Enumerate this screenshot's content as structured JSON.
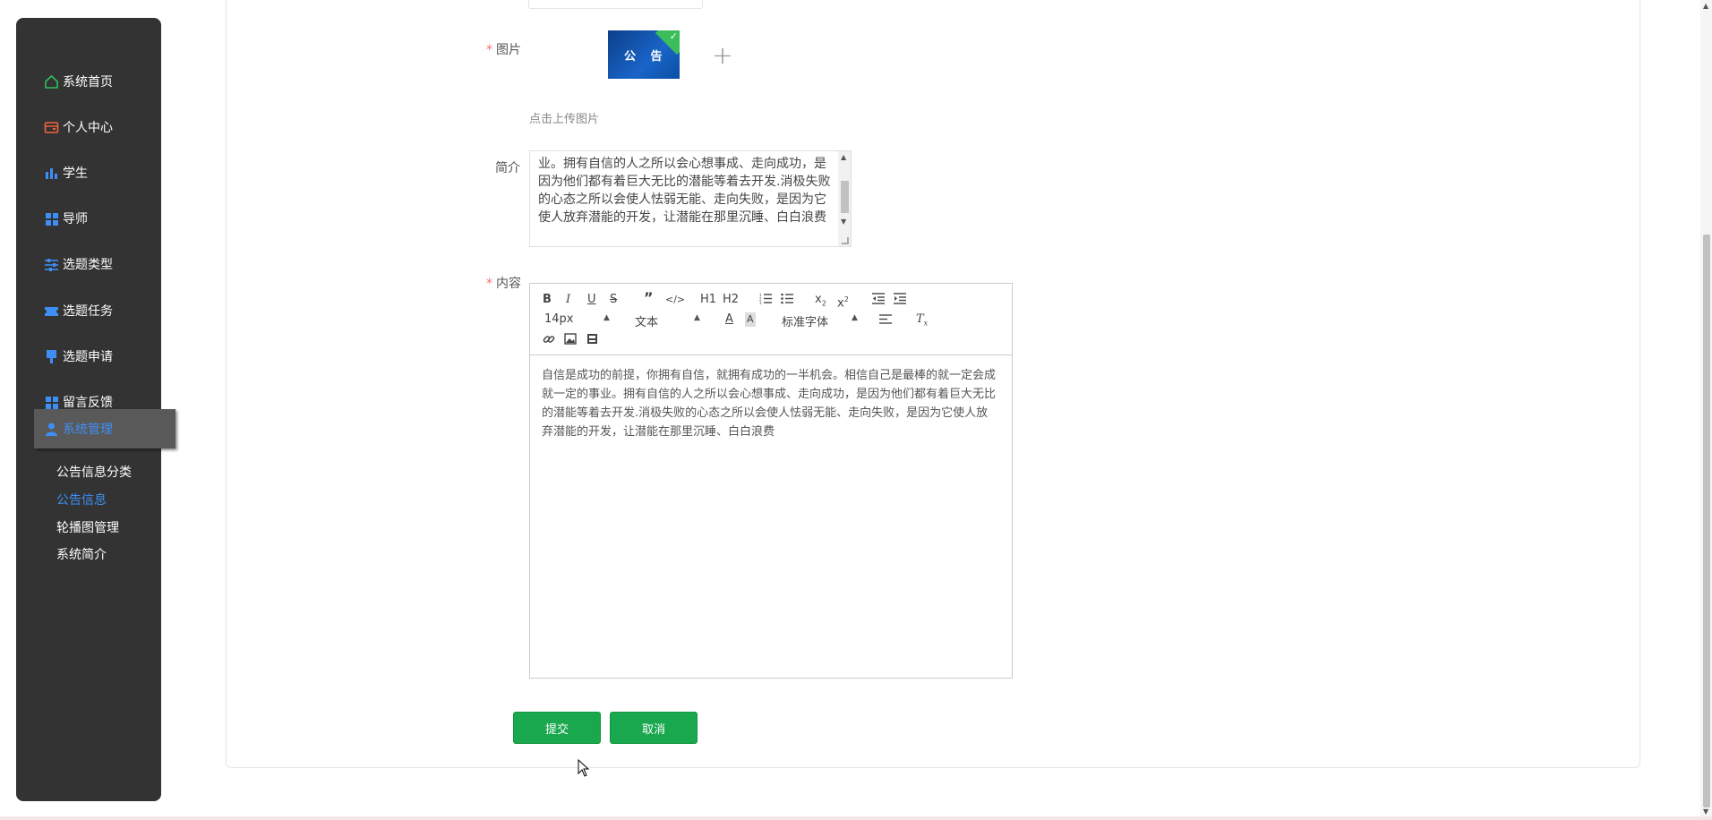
{
  "sidebar": {
    "items": [
      {
        "label": "系统首页",
        "icon": "home-icon",
        "color": "#2fbf5a"
      },
      {
        "label": "个人中心",
        "icon": "wallet-icon",
        "color": "#f0643c"
      },
      {
        "label": "学生",
        "icon": "bar-chart-icon",
        "color": "#3e8ff5"
      },
      {
        "label": "导师",
        "icon": "grid-icon",
        "color": "#3e8ff5"
      },
      {
        "label": "选题类型",
        "icon": "sliders-icon",
        "color": "#3e8ff5"
      },
      {
        "label": "选题任务",
        "icon": "ticket-icon",
        "color": "#3e8ff5"
      },
      {
        "label": "选题申请",
        "icon": "pin-icon",
        "color": "#3e8ff5"
      },
      {
        "label": "留言反馈",
        "icon": "grid-icon",
        "color": "#3e8ff5"
      },
      {
        "label": "系统管理",
        "icon": "user-icon",
        "color": "#3e8ff5"
      }
    ],
    "sub_items": [
      {
        "label": "公告信息分类"
      },
      {
        "label": "公告信息"
      },
      {
        "label": "轮播图管理"
      },
      {
        "label": "系统简介"
      }
    ],
    "active_sub": "公告信息"
  },
  "form": {
    "image_label": "图片",
    "upload_thumb_text": "公 告",
    "upload_tip": "点击上传图片",
    "summary_label": "简介",
    "summary_value": "业。拥有自信的人之所以会心想事成、走向成功，是因为他们都有着巨大无比的潜能等着去开发.消极失败的心态之所以会使人怯弱无能、走向失败，是因为它使人放弃潜能的开发，让潜能在那里沉睡、白白浪费",
    "content_label": "内容",
    "toolbar": {
      "font_size": "14px",
      "text_type": "文本",
      "font_family": "标准字体",
      "h1": "H1",
      "h2": "H2"
    },
    "content_value": "自信是成功的前提，你拥有自信，就拥有成功的一半机会。相信自己是最棒的就一定会成就一定的事业。拥有自信的人之所以会心想事成、走向成功，是因为他们都有着巨大无比的潜能等着去开发.消极失败的心态之所以会使人怯弱无能、走向失败，是因为它使人放弃潜能的开发，让潜能在那里沉睡、白白浪费"
  },
  "buttons": {
    "submit": "提交",
    "cancel": "取消"
  },
  "colors": {
    "sidebar_bg": "#333333",
    "accent_blue": "#3e8ff5",
    "button_green": "#19a84e",
    "required_red": "#f56c6c"
  }
}
